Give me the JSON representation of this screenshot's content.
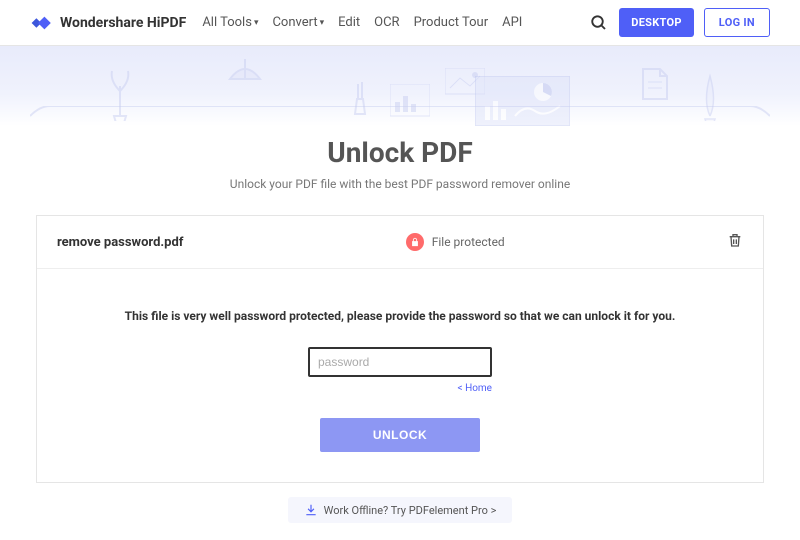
{
  "header": {
    "brand": "Wondershare HiPDF",
    "nav": {
      "all_tools": "All Tools",
      "convert": "Convert",
      "edit": "Edit",
      "ocr": "OCR",
      "product_tour": "Product Tour",
      "api": "API"
    },
    "desktop_btn": "DESKTOP",
    "login_btn": "LOG IN"
  },
  "page": {
    "title": "Unlock PDF",
    "subtitle": "Unlock your PDF file with the best PDF password remover online"
  },
  "file": {
    "name": "remove password.pdf",
    "status": "File protected"
  },
  "form": {
    "instruction": "This file is very well password protected, please provide the password so that we can unlock it for you.",
    "placeholder": "password",
    "home_link": "< Home",
    "unlock_btn": "UNLOCK"
  },
  "footer": {
    "promo": "Work Offline? Try PDFelement Pro >"
  }
}
